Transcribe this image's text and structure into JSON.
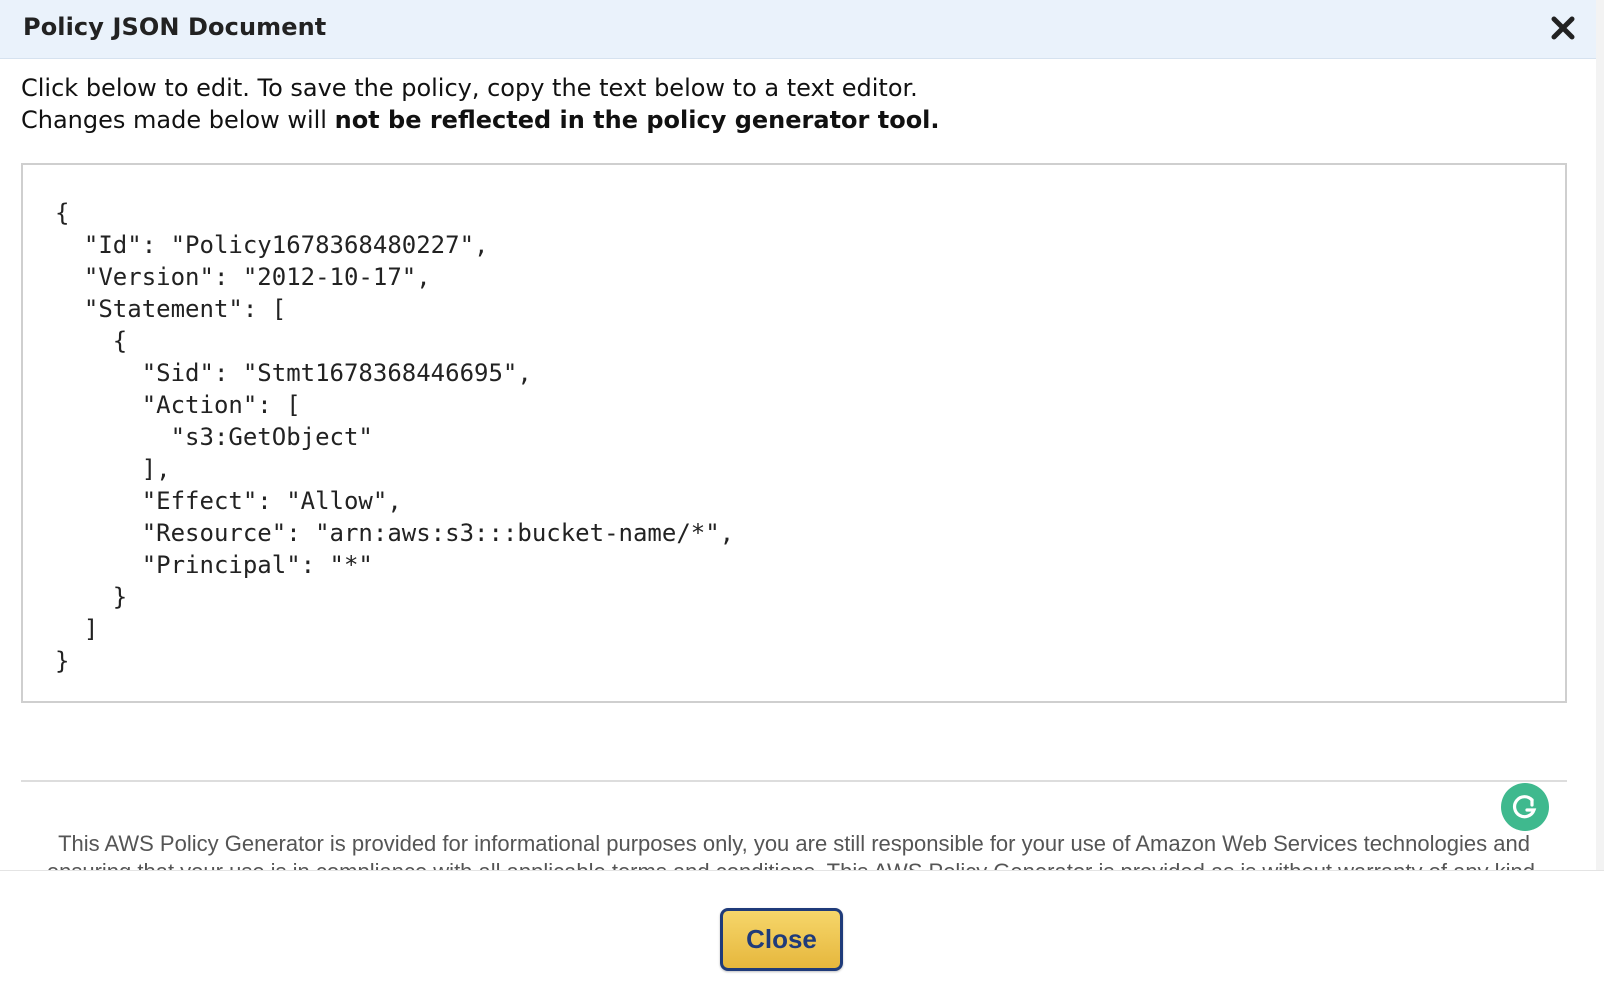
{
  "dialog": {
    "title": "Policy JSON Document",
    "close_icon": "close-x-icon"
  },
  "instructions": {
    "line1": "Click below to edit. To save the policy, copy the text below to a text editor.",
    "line2_prefix": "Changes made below will ",
    "line2_bold": "not be reflected in the policy generator tool."
  },
  "editor": {
    "json_text": "{\n  \"Id\": \"Policy1678368480227\",\n  \"Version\": \"2012-10-17\",\n  \"Statement\": [\n    {\n      \"Sid\": \"Stmt1678368446695\",\n      \"Action\": [\n        \"s3:GetObject\"\n      ],\n      \"Effect\": \"Allow\",\n      \"Resource\": \"arn:aws:s3:::bucket-name/*\",\n      \"Principal\": \"*\"\n    }\n  ]\n}",
    "grammarly_icon": "grammarly-icon"
  },
  "disclaimer": {
    "text": "This AWS Policy Generator is provided for informational purposes only, you are still responsible for your use of Amazon Web Services technologies and ensuring that your use is in compliance with all applicable terms and conditions. This AWS Policy Generator is provided as is without warranty of any kind, whether express"
  },
  "footer": {
    "close_label": "Close"
  },
  "colors": {
    "title_bar": "#eaf2fb",
    "button_gold": "#e6b73d",
    "button_border": "#1f3b7a",
    "grammarly": "#3fb98e"
  }
}
